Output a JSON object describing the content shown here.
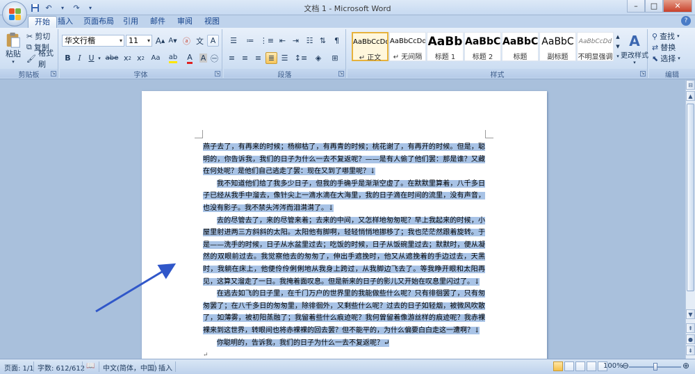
{
  "window": {
    "title": "文档 1 - Microsoft Word"
  },
  "tabs": [
    {
      "label": "开始",
      "active": true
    },
    {
      "label": "插入"
    },
    {
      "label": "页面布局"
    },
    {
      "label": "引用"
    },
    {
      "label": "邮件"
    },
    {
      "label": "审阅"
    },
    {
      "label": "视图"
    }
  ],
  "ribbon": {
    "clipboard": {
      "label": "剪贴板",
      "paste": "粘贴",
      "cut": "剪切",
      "copy": "复制",
      "format_painter": "格式刷"
    },
    "font": {
      "label": "字体",
      "font_name": "华文行楷",
      "font_size": "11",
      "grow": "A",
      "shrink": "A",
      "bold": "B",
      "italic": "I",
      "underline": "U",
      "strike": "abe",
      "subscript": "x",
      "superscript": "x",
      "change_case": "Aa",
      "clear": "A",
      "font_color_letter": "A"
    },
    "paragraph": {
      "label": "段落"
    },
    "styles": {
      "label": "样式",
      "items": [
        {
          "sample": "AaBbCcDd",
          "name": "↵ 正文",
          "selected": true
        },
        {
          "sample": "AaBbCcDd",
          "name": "↵ 无间隔"
        },
        {
          "sample": "AaBb",
          "name": "标题 1"
        },
        {
          "sample": "AaBbC",
          "name": "标题 2"
        },
        {
          "sample": "AaBbC",
          "name": "标题"
        },
        {
          "sample": "AaBbC",
          "name": "副标题"
        },
        {
          "sample": "AaBbCcDd",
          "name": "不明显强调"
        }
      ],
      "change_styles": "更改样式"
    },
    "editing": {
      "label": "编辑",
      "find": "查找",
      "replace": "替换",
      "select": "选择"
    }
  },
  "document": {
    "paragraphs": [
      "燕子去了，有再来的时候；杨柳枯了，有再青的时候；桃花谢了，有再开的时候。但是，聪明的，你告诉我，我们的日子为什么一去不复返呢？——是有人偷了他们罢：那是谁？又藏在何处呢？是他们自己逃走了罢：现在又到了哪里呢？↓",
      "我不知道他们给了我多少日子，但我的手确乎是渐渐空虚了。在默默里算着，八千多日子已经从我手中溜去，像针尖上一滴水滴在大海里，我的日子滴在时间的流里，没有声音，也没有影子。我不禁头涔涔而泪潸潸了。↓",
      "去的尽管去了，来的尽管来着；去来的中间，又怎样地匆匆呢？早上我起来的时候，小屋里射进两三方斜斜的太阳。太阳他有脚啊，轻轻悄悄地挪移了；我也茫茫然跟着旋转。于是——洗手的时候，日子从水盆里过去；吃饭的时候，日子从饭碗里过去；默默时，便从凝然的双眼前过去。我觉察他去的匆匆了，伸出手遮挽时，他又从遮挽着的手边过去，天黑时，我躺在床上，他便伶伶俐俐地从我身上跨过，从我脚边飞去了。等我睁开眼和太阳再见，这算又溜走了一日。我掩着面叹息。但是新来的日子的影儿又开始在叹息里闪过了。↓",
      "在逃去如飞的日子里，在千门万户的世界里的我能做些什么呢？只有徘徊罢了，只有匆匆罢了；在八千多日的匆匆里，除徘徊外，又剩些什么呢？过去的日子如轻烟，被微风吹散了，如薄雾，被初阳蒸融了；我留着些什么痕迹呢？我何曾留着像游丝样的痕迹呢？我赤裸裸来到这世界，转眼间也将赤裸裸的回去罢？但不能平的，为什么偏要白白走这一遭啊？↓",
      "你聪明的，告诉我，我们的日子为什么一去不复返呢？↵"
    ],
    "trailing_mark": "↵"
  },
  "status": {
    "page": "页面: 1/1",
    "words": "字数: 612/612",
    "language": "中文(简体，中国)",
    "mode": "插入",
    "zoom": "100%",
    "zoom_level": 1.0
  },
  "colors": {
    "selection": "#a8c3e6",
    "arrow": "#3057c9"
  }
}
